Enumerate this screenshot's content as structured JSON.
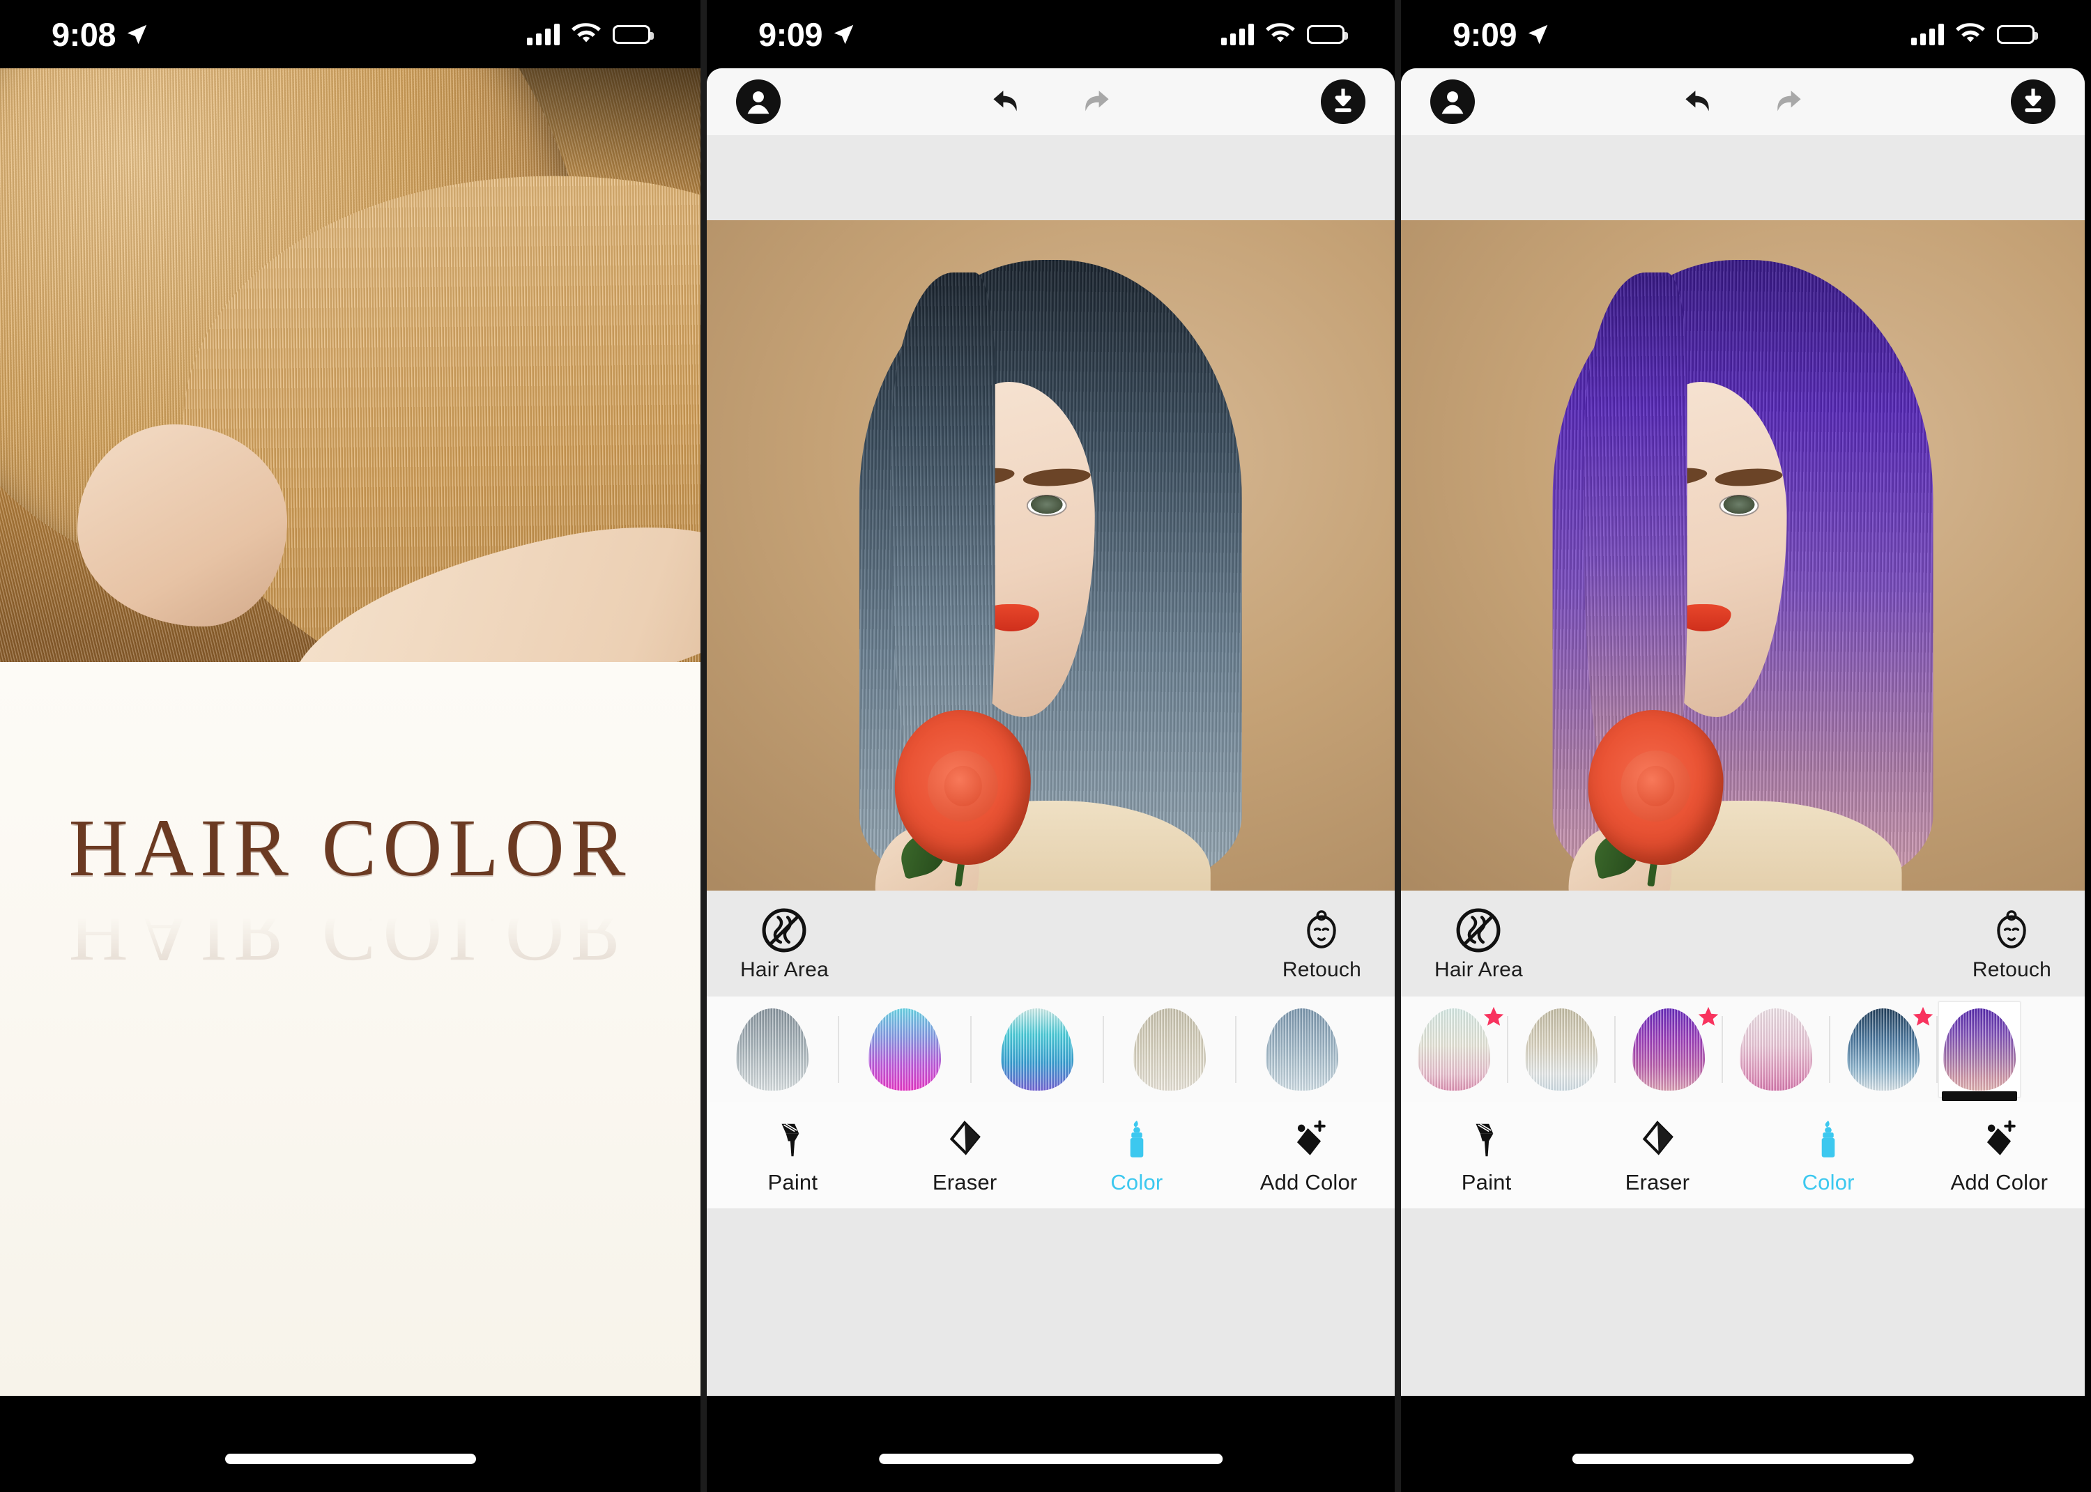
{
  "app": {
    "title": "HAIR COLOR",
    "accent": "#3cc8ef",
    "title_color": "#6b3a22",
    "star_color": "#f8335e"
  },
  "screens": [
    {
      "name": "splash",
      "status": {
        "time": "9:08",
        "location_icon": "location-arrow-icon",
        "signal_icon": "cellular-signal-icon",
        "wifi_icon": "wifi-icon",
        "battery_icon": "battery-full-icon"
      },
      "hero_image": "blonde-hair-model-photo",
      "title": "HAIR COLOR"
    },
    {
      "name": "editor-blue",
      "status": {
        "time": "9:09",
        "location_icon": "location-arrow-icon",
        "signal_icon": "cellular-signal-icon",
        "wifi_icon": "wifi-icon",
        "battery_icon": "battery-full-icon"
      },
      "toolbar": {
        "profile_icon": "person-avatar-icon",
        "undo_icon": "undo-arrow-icon",
        "redo_icon": "redo-arrow-icon",
        "save_icon": "download-save-icon",
        "undo_enabled": true,
        "redo_enabled": false
      },
      "photo": {
        "subject": "woman-with-rose-photo",
        "hair_color_label": "slate-blue",
        "hair_gradient": "linear-gradient(180deg,#1b2530 0%,#3c4f60 28%,#6e8496 62%,#9fb1bd 100%)"
      },
      "area_tools": [
        {
          "label": "Hair Area",
          "icon": "hair-strand-icon"
        },
        {
          "label": "Retouch",
          "icon": "face-retouch-icon"
        }
      ],
      "swatches": [
        {
          "id": "sw1",
          "premium": false,
          "gradient": "linear-gradient(180deg,#8d9aa4 0%,#a9b6bd 40%,#dfe6e8 100%)"
        },
        {
          "id": "sw2",
          "premium": false,
          "gradient": "linear-gradient(180deg,#6fe0f2 0%,#8ea0ef 35%,#c860e8 68%,#f23bd1 100%)"
        },
        {
          "id": "sw3",
          "premium": false,
          "gradient": "linear-gradient(180deg,#d8f6f3 0%,#4ed6e4 32%,#3aa7dd 66%,#7b6ae0 100%)"
        },
        {
          "id": "sw4",
          "premium": false,
          "gradient": "linear-gradient(180deg,#cfc9b4 0%,#ded8c4 45%,#efeade 100%)"
        },
        {
          "id": "sw5",
          "premium": false,
          "gradient": "linear-gradient(180deg,#7f9cb4 0%,#a3bccd 45%,#d5e4ec 100%)"
        }
      ],
      "tabs": [
        {
          "label": "Paint",
          "icon": "paint-brush-icon",
          "active": false
        },
        {
          "label": "Eraser",
          "icon": "eraser-icon",
          "active": false
        },
        {
          "label": "Color",
          "icon": "color-tube-icon",
          "active": true
        },
        {
          "label": "Add Color",
          "icon": "add-color-icon",
          "active": false
        }
      ]
    },
    {
      "name": "editor-purple",
      "status": {
        "time": "9:09",
        "location_icon": "location-arrow-icon",
        "signal_icon": "cellular-signal-icon",
        "wifi_icon": "wifi-icon",
        "battery_icon": "battery-full-icon"
      },
      "toolbar": {
        "profile_icon": "person-avatar-icon",
        "undo_icon": "undo-arrow-icon",
        "redo_icon": "redo-arrow-icon",
        "save_icon": "download-save-icon",
        "undo_enabled": true,
        "redo_enabled": false
      },
      "photo": {
        "subject": "woman-with-rose-photo",
        "hair_color_label": "violet-purple",
        "hair_gradient": "linear-gradient(180deg,#3a1a8c 0%,#5b2bbf 24%,#7d4fc4 52%,#b07fae 80%,#d9a4b4 100%)"
      },
      "area_tools": [
        {
          "label": "Hair Area",
          "icon": "hair-strand-icon"
        },
        {
          "label": "Retouch",
          "icon": "face-retouch-icon"
        }
      ],
      "swatches": [
        {
          "id": "sw1",
          "premium": true,
          "gradient": "linear-gradient(180deg,#dff3ee 0%,#f0efe2 45%,#f3c9d8 80%,#e898bb 100%)"
        },
        {
          "id": "sw2",
          "premium": false,
          "gradient": "linear-gradient(180deg,#cbc4ab 0%,#e3dcc8 45%,#eef2f2 80%,#d8e6ee 100%)"
        },
        {
          "id": "sw3",
          "premium": true,
          "gradient": "linear-gradient(180deg,#6b2bc4 0%,#a341c2 38%,#c263b4 70%,#e3a5bb 100%)"
        },
        {
          "id": "sw4",
          "premium": false,
          "gradient": "linear-gradient(180deg,#f6e9ef 0%,#f3cfe0 45%,#ea9ec6 80%,#e07fb6 100%)"
        },
        {
          "id": "sw5",
          "premium": true,
          "gradient": "linear-gradient(180deg,#22415f 0%,#4d7ba3 38%,#8fb9d4 72%,#dfeaf0 100%)"
        },
        {
          "id": "sw6",
          "premium": false,
          "selected": true,
          "gradient": "linear-gradient(180deg,#5a2bb5 0%,#8352c0 30%,#b07fb5 62%,#d99fb0 85%,#e7b7b6 100%)"
        }
      ],
      "tabs": [
        {
          "label": "Paint",
          "icon": "paint-brush-icon",
          "active": false
        },
        {
          "label": "Eraser",
          "icon": "eraser-icon",
          "active": false
        },
        {
          "label": "Color",
          "icon": "color-tube-icon",
          "active": true
        },
        {
          "label": "Add Color",
          "icon": "add-color-icon",
          "active": false
        }
      ]
    }
  ]
}
